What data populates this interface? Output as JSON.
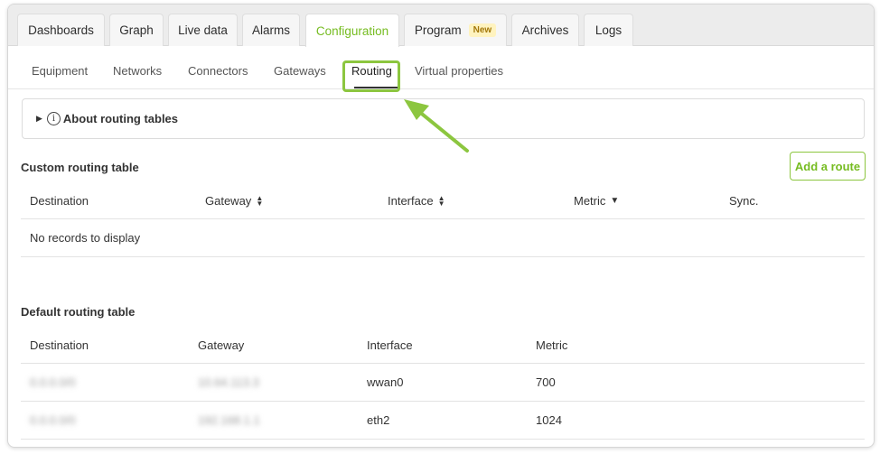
{
  "tabs": [
    {
      "label": "Dashboards"
    },
    {
      "label": "Graph"
    },
    {
      "label": "Live data"
    },
    {
      "label": "Alarms"
    },
    {
      "label": "Configuration",
      "active": true
    },
    {
      "label": "Program",
      "badge": "New"
    },
    {
      "label": "Archives"
    },
    {
      "label": "Logs"
    }
  ],
  "subtabs": [
    {
      "label": "Equipment"
    },
    {
      "label": "Networks"
    },
    {
      "label": "Connectors"
    },
    {
      "label": "Gateways"
    },
    {
      "label": "Routing",
      "active": true
    },
    {
      "label": "Virtual properties"
    }
  ],
  "about": {
    "label": "About routing tables",
    "icon": "info-icon"
  },
  "custom_table": {
    "title": "Custom routing table",
    "add_button": "Add a route",
    "columns": [
      "Destination",
      "Gateway",
      "Interface",
      "Metric",
      "Sync."
    ],
    "empty_text": "No records to display"
  },
  "default_table": {
    "title": "Default routing table",
    "columns": [
      "Destination",
      "Gateway",
      "Interface",
      "Metric"
    ],
    "rows": [
      {
        "destination": "0.0.0.0/0",
        "gateway": "10.64.113.3",
        "interface": "wwan0",
        "metric": "700"
      },
      {
        "destination": "0.0.0.0/0",
        "gateway": "192.168.1.1",
        "interface": "eth2",
        "metric": "1024"
      }
    ]
  },
  "colors": {
    "accent": "#76bc21",
    "annotation": "#8cc63f"
  }
}
